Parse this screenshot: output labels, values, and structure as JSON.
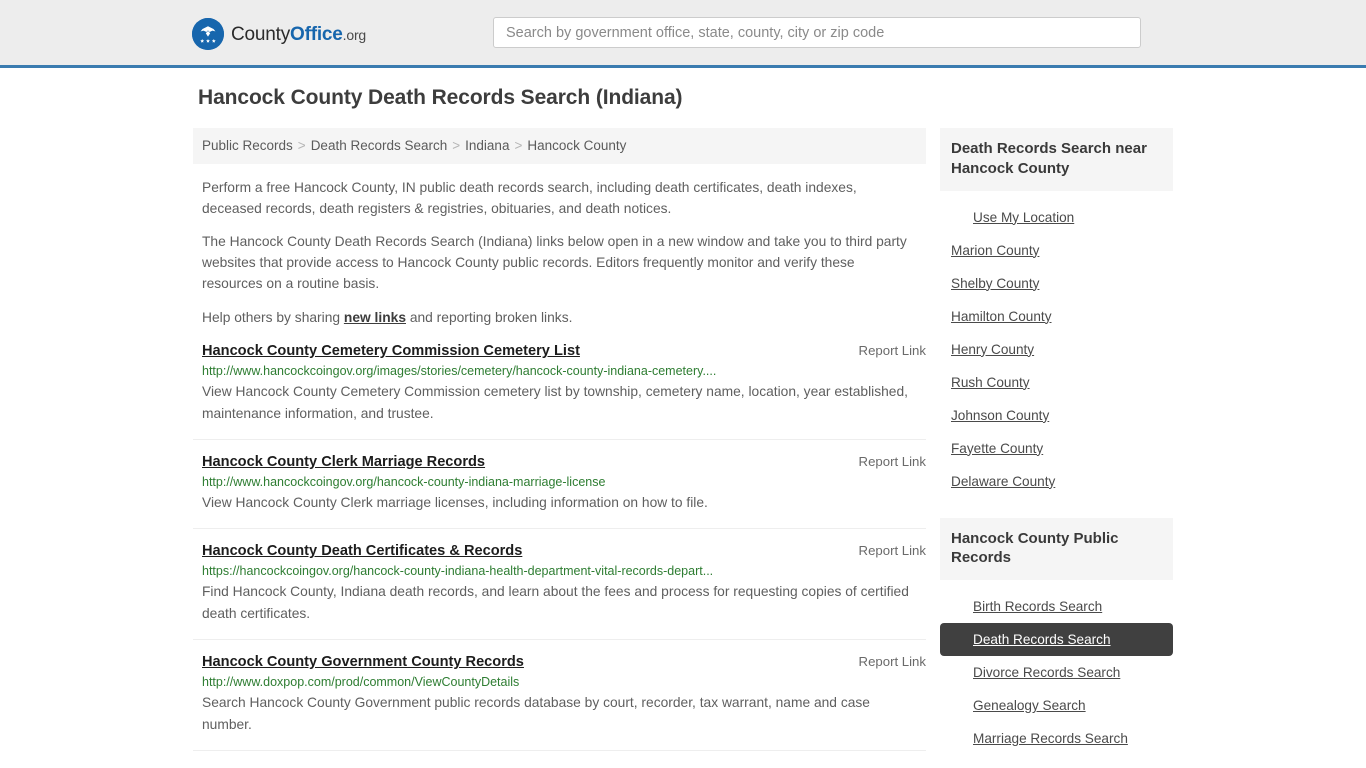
{
  "header": {
    "logo": {
      "icon": "eagle-shield-icon",
      "text_primary": "County",
      "text_accent": "Office",
      "text_suffix": ".org"
    },
    "search": {
      "placeholder": "Search by government office, state, county, city or zip code",
      "value": ""
    }
  },
  "page": {
    "title": "Hancock County Death Records Search (Indiana)"
  },
  "breadcrumb": {
    "items": [
      {
        "label": "Public Records",
        "current": false
      },
      {
        "label": "Death Records Search",
        "current": false
      },
      {
        "label": "Indiana",
        "current": false
      },
      {
        "label": "Hancock County",
        "current": true
      }
    ],
    "separator": ">"
  },
  "intro": {
    "paragraph_1": "Perform a free Hancock County, IN public death records search, including death certificates, death indexes, deceased records, death registers & registries, obituaries, and death notices.",
    "paragraph_2": "The Hancock County Death Records Search (Indiana) links below open in a new window and take you to third party websites that provide access to Hancock County public records. Editors frequently monitor and verify these resources on a routine basis.",
    "share_prefix": "Help others by sharing ",
    "share_link": "new links",
    "share_suffix": " and reporting broken links."
  },
  "results": {
    "report_label": "Report Link",
    "items": [
      {
        "title": "Hancock County Cemetery Commission Cemetery List",
        "url": "http://www.hancockcoingov.org/images/stories/cemetery/hancock-county-indiana-cemetery....",
        "description": "View Hancock County Cemetery Commission cemetery list by township, cemetery name, location, year established, maintenance information, and trustee.",
        "report": "Report Link"
      },
      {
        "title": "Hancock County Clerk Marriage Records",
        "url": "http://www.hancockcoingov.org/hancock-county-indiana-marriage-license",
        "description": "View Hancock County Clerk marriage licenses, including information on how to file.",
        "report": "Report Link"
      },
      {
        "title": "Hancock County Death Certificates & Records",
        "url": "https://hancockcoingov.org/hancock-county-indiana-health-department-vital-records-depart...",
        "description": "Find Hancock County, Indiana death records, and learn about the fees and process for requesting copies of certified death certificates.",
        "report": "Report Link"
      },
      {
        "title": "Hancock County Government County Records",
        "url": "http://www.doxpop.com/prod/common/ViewCountyDetails",
        "description": "Search Hancock County Government public records database by court, recorder, tax warrant, name and case number.",
        "report": "Report Link"
      }
    ]
  },
  "sidebar": {
    "panels": [
      {
        "title": "Death Records Search near Hancock County",
        "items": [
          {
            "label": "Use My Location",
            "indent": true,
            "active": false
          },
          {
            "label": "Marion County",
            "indent": false,
            "active": false
          },
          {
            "label": "Shelby County",
            "indent": false,
            "active": false
          },
          {
            "label": "Hamilton County",
            "indent": false,
            "active": false
          },
          {
            "label": "Henry County",
            "indent": false,
            "active": false
          },
          {
            "label": "Rush County",
            "indent": false,
            "active": false
          },
          {
            "label": "Johnson County",
            "indent": false,
            "active": false
          },
          {
            "label": "Fayette County",
            "indent": false,
            "active": false
          },
          {
            "label": "Delaware County",
            "indent": false,
            "active": false
          }
        ]
      },
      {
        "title": "Hancock County Public Records",
        "items": [
          {
            "label": "Birth Records Search",
            "indent": true,
            "active": false
          },
          {
            "label": "Death Records Search",
            "indent": true,
            "active": true
          },
          {
            "label": "Divorce Records Search",
            "indent": true,
            "active": false
          },
          {
            "label": "Genealogy Search",
            "indent": true,
            "active": false
          },
          {
            "label": "Marriage Records Search",
            "indent": true,
            "active": false
          }
        ]
      }
    ]
  },
  "colors": {
    "brand_blue": "#1766ad",
    "header_rule": "#3b7cb0",
    "url_green": "#2e7d32",
    "active_bg": "#404040",
    "panel_bg": "#f5f5f5"
  }
}
